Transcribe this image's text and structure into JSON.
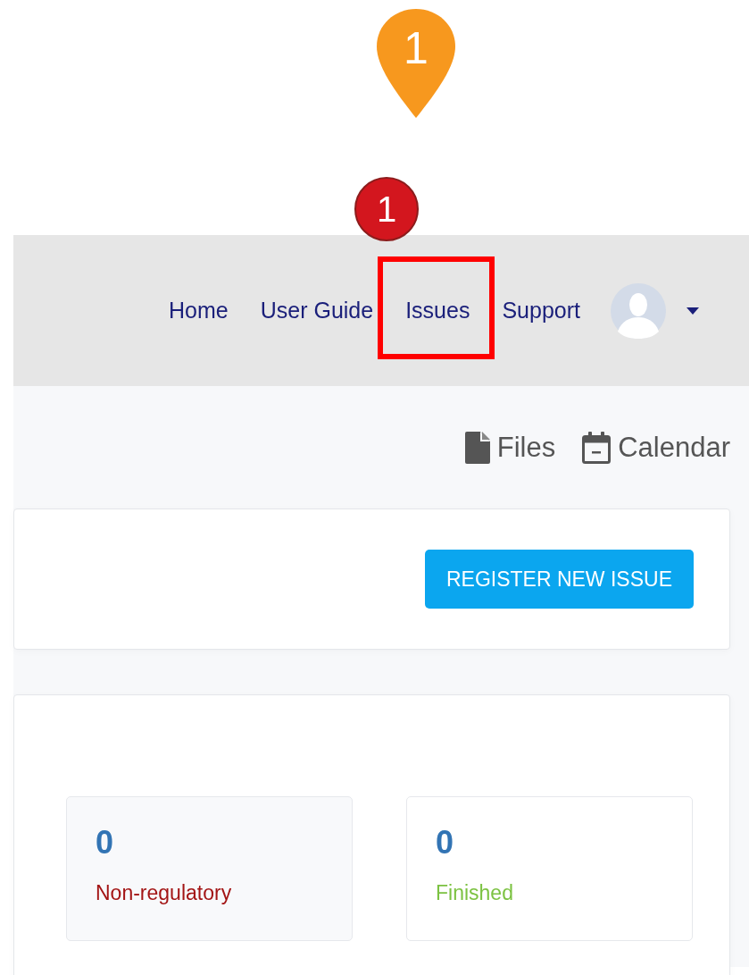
{
  "annotations": {
    "pin": {
      "label": "1"
    },
    "badge": {
      "label": "1"
    }
  },
  "nav": {
    "items": [
      {
        "label": "Home",
        "highlighted": false
      },
      {
        "label": "User Guide",
        "highlighted": false
      },
      {
        "label": "Issues",
        "highlighted": true
      },
      {
        "label": "Support",
        "highlighted": false
      }
    ]
  },
  "toolbar": {
    "links": [
      {
        "label": "Files",
        "kind": "files"
      },
      {
        "label": "Calendar",
        "kind": "calendar"
      }
    ]
  },
  "actions": {
    "button": "REGISTER NEW ISSUE"
  },
  "stats": [
    {
      "value": "0",
      "label": "Non-regulatory",
      "color": "#a31515"
    },
    {
      "value": "0",
      "label": "Finished",
      "color": "#7cc242"
    }
  ]
}
